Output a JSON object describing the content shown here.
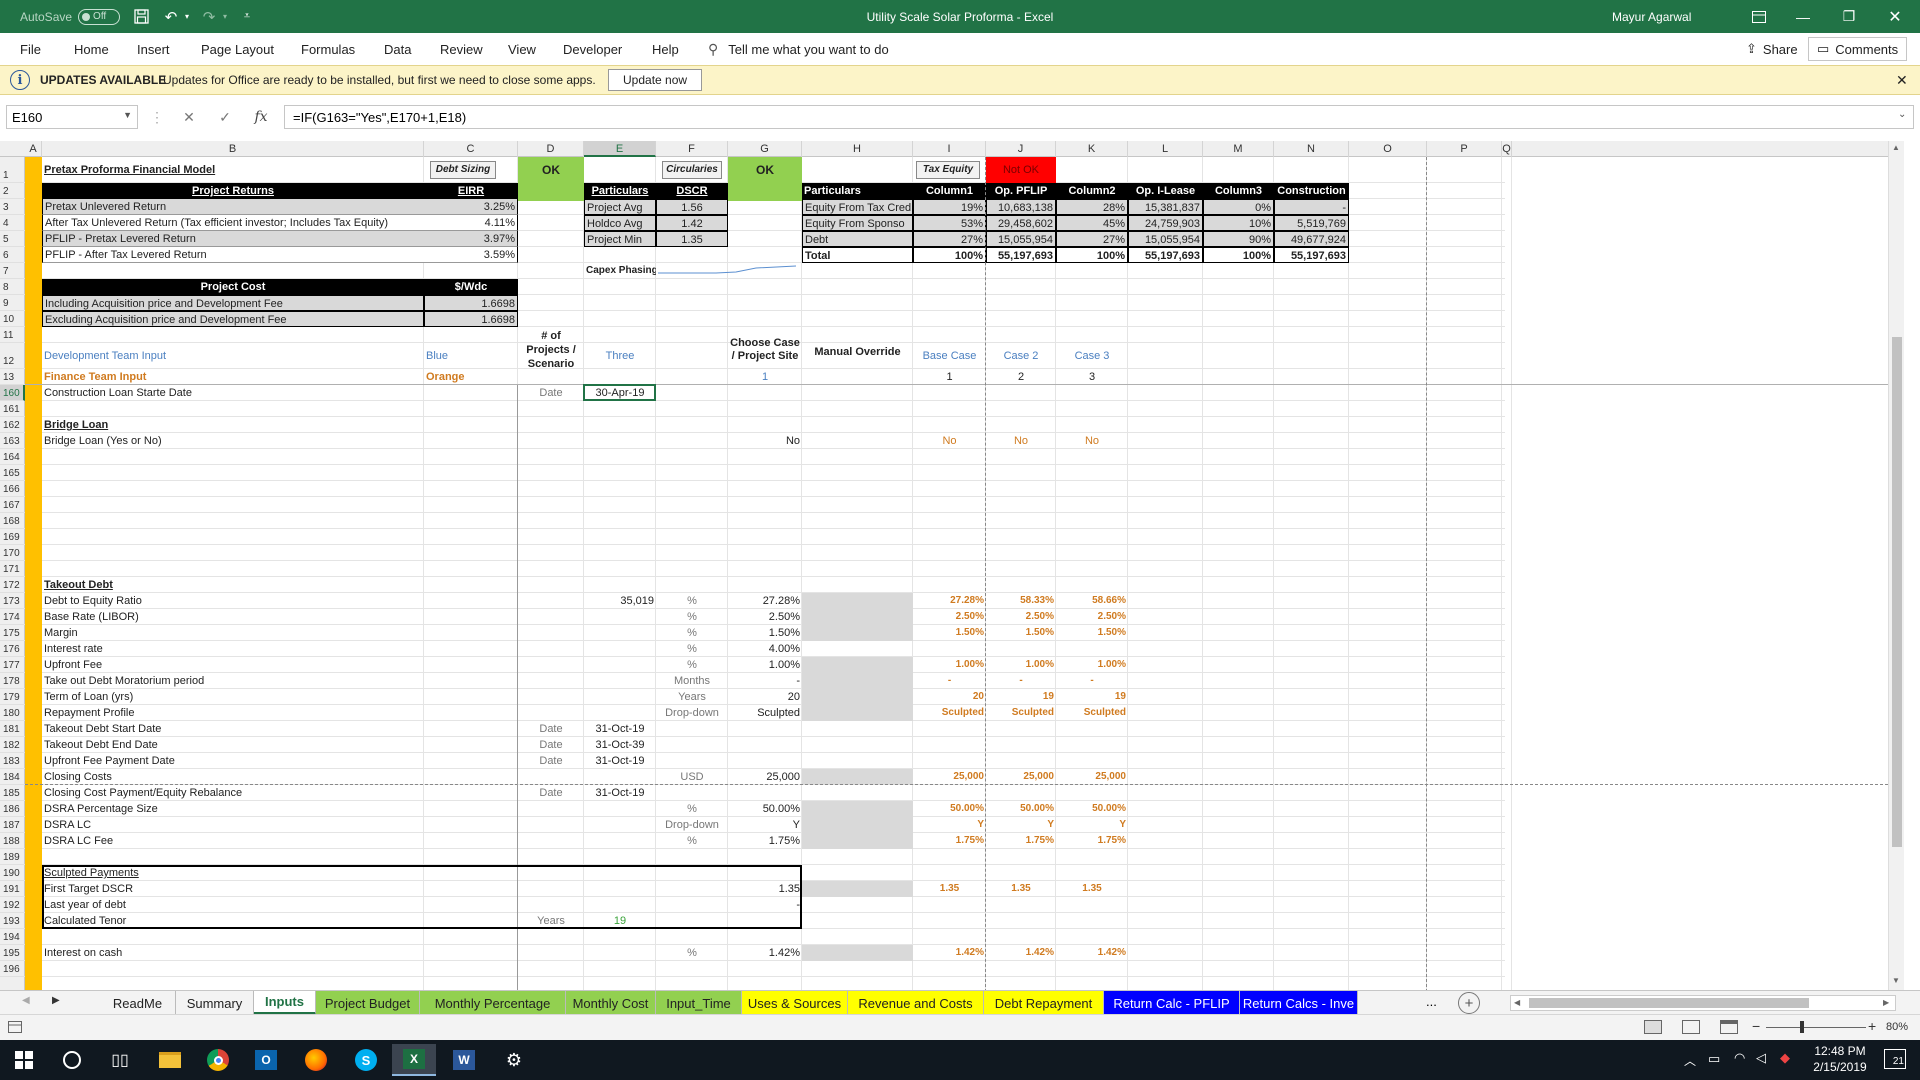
{
  "titlebar": {
    "autosave_label": "AutoSave",
    "autosave_state": "Off",
    "title": "Utility Scale Solar Proforma  -  Excel",
    "user": "Mayur Agarwal"
  },
  "ribbon": {
    "tabs": [
      "File",
      "Home",
      "Insert",
      "Page Layout",
      "Formulas",
      "Data",
      "Review",
      "View",
      "Developer",
      "Help"
    ],
    "tell_me": "Tell me what you want to do",
    "share": "Share",
    "comments": "Comments"
  },
  "updatebar": {
    "title": "UPDATES AVAILABLE",
    "message": "Updates for Office are ready to be installed, but first we need to close some apps.",
    "button": "Update now"
  },
  "formulabar": {
    "cell_ref": "E160",
    "formula": "=IF(G163=\"Yes\",E170+1,E18)",
    "fx": "fx"
  },
  "columns": [
    "A",
    "B",
    "C",
    "D",
    "E",
    "F",
    "G",
    "H",
    "I",
    "J",
    "K",
    "L",
    "M",
    "N",
    "O",
    "P",
    "Q"
  ],
  "rows": [
    "1",
    "2",
    "3",
    "4",
    "5",
    "6",
    "7",
    "8",
    "9",
    "10",
    "11",
    "12",
    "13",
    "160",
    "161",
    "162",
    "163",
    "164",
    "165",
    "166",
    "167",
    "168",
    "169",
    "170",
    "171",
    "172",
    "173",
    "174",
    "175",
    "176",
    "177",
    "178",
    "179",
    "180",
    "181",
    "182",
    "183",
    "184",
    "185",
    "186",
    "187",
    "188",
    "189",
    "190",
    "191",
    "192",
    "193",
    "194",
    "195",
    "196"
  ],
  "top": {
    "model_title": "Pretax Proforma Financial Model",
    "btn_debt_sizing": "Debt Sizing",
    "ok1": "OK",
    "btn_circularies": "Circularies",
    "ok2": "OK",
    "btn_tax_equity": "Tax Equity",
    "not_ok": "Not OK",
    "returns_header": "Project Returns",
    "eirr_header": "EIRR",
    "returns": [
      [
        "Pretax Unlevered Return",
        "3.25%"
      ],
      [
        "After Tax Unlevered Return (Tax efficient investor; Includes Tax Equity)",
        "4.11%"
      ],
      [
        "PFLIP - Pretax Levered Return",
        "3.97%"
      ],
      [
        "PFLIP - After Tax Levered Return",
        "3.59%"
      ]
    ],
    "dscr_headers": [
      "Particulars",
      "DSCR"
    ],
    "dscr": [
      [
        "Project Avg",
        "1.56"
      ],
      [
        "Holdco Avg",
        "1.42"
      ],
      [
        "Project Min",
        "1.35"
      ]
    ],
    "capex_label": "Capex Phasing",
    "cost_header": "Project Cost",
    "cost_unit": "$/Wdc",
    "costs": [
      [
        "Including Acquisition price and Development Fee",
        "1.6698"
      ],
      [
        "Excluding Acquisition price and Development Fee",
        "1.6698"
      ]
    ],
    "equity_headers": [
      "Particulars",
      "Column1",
      "Op. PFLIP",
      "Column2",
      "Op. I-Lease",
      "Column3",
      "Construction"
    ],
    "equity": [
      [
        "Equity From Tax Cred",
        "19%",
        "10,683,138",
        "28%",
        "15,381,837",
        "0%",
        "-"
      ],
      [
        "Equity From Sponso",
        "53%",
        "29,458,602",
        "45%",
        "24,759,903",
        "10%",
        "5,519,769"
      ],
      [
        "Debt",
        "27%",
        "15,055,954",
        "27%",
        "15,055,954",
        "90%",
        "49,677,924"
      ],
      [
        "Total",
        "100%",
        "55,197,693",
        "100%",
        "55,197,693",
        "100%",
        "55,197,693"
      ]
    ]
  },
  "legend": {
    "dev_input": "Development Team Input",
    "dev_color": "Blue",
    "fin_input": "Finance Team Input",
    "fin_color": "Orange",
    "projects_label": "# of Projects / Scenario",
    "projects_value": "Three",
    "choose_case": "Choose Case / Project Site",
    "choose_value": "1",
    "manual_override": "Manual Override",
    "case_labels": [
      "Base Case",
      "Case 2",
      "Case 3"
    ],
    "case_numbers": [
      "1",
      "2",
      "3"
    ]
  },
  "body": {
    "r160": {
      "label": "Construction Loan Starte Date",
      "unit": "Date",
      "value": "30-Apr-19"
    },
    "r162": "Bridge Loan",
    "r163": {
      "label": "Bridge Loan (Yes or No)",
      "g": "No",
      "cases": [
        "No",
        "No",
        "No"
      ]
    },
    "r172": "Takeout Debt",
    "takeout": [
      {
        "label": "Debt to Equity Ratio",
        "e": "35,019",
        "f": "%",
        "g": "27.28%",
        "cases": [
          "27.28%",
          "58.33%",
          "58.66%"
        ]
      },
      {
        "label": "Base Rate (LIBOR)",
        "f": "%",
        "g": "2.50%",
        "cases": [
          "2.50%",
          "2.50%",
          "2.50%"
        ]
      },
      {
        "label": "Margin",
        "f": "%",
        "g": "1.50%",
        "cases": [
          "1.50%",
          "1.50%",
          "1.50%"
        ]
      },
      {
        "label": "Interest rate",
        "f": "%",
        "g": "4.00%",
        "cases": [
          "",
          "",
          ""
        ]
      },
      {
        "label": "Upfront Fee",
        "f": "%",
        "g": "1.00%",
        "cases": [
          "1.00%",
          "1.00%",
          "1.00%"
        ]
      },
      {
        "label": "Take out Debt Moratorium period",
        "f": "Months",
        "g": "-",
        "cases": [
          "-",
          "-",
          "-"
        ]
      },
      {
        "label": "Term of Loan (yrs)",
        "f": "Years",
        "g": "20",
        "cases": [
          "20",
          "19",
          "19"
        ]
      },
      {
        "label": "Repayment Profile",
        "f": "Drop-down",
        "g": "Sculpted",
        "cases": [
          "Sculpted",
          "Sculpted",
          "Sculpted"
        ]
      },
      {
        "label": "Takeout Debt Start Date",
        "d": "Date",
        "e": "31-Oct-19"
      },
      {
        "label": "Takeout Debt End Date",
        "d": "Date",
        "e": "31-Oct-39"
      },
      {
        "label": "Upfront Fee Payment Date",
        "d": "Date",
        "e": "31-Oct-19"
      },
      {
        "label": "Closing Costs",
        "f": "USD",
        "g": "25,000",
        "cases": [
          "25,000",
          "25,000",
          "25,000"
        ]
      },
      {
        "label": "Closing Cost Payment/Equity Rebalance",
        "d": "Date",
        "e": "31-Oct-19"
      },
      {
        "label": "DSRA Percentage Size",
        "f": "%",
        "g": "50.00%",
        "cases": [
          "50.00%",
          "50.00%",
          "50.00%"
        ]
      },
      {
        "label": "DSRA LC",
        "f": "Drop-down",
        "g": "Y",
        "cases": [
          "Y",
          "Y",
          "Y"
        ]
      },
      {
        "label": "DSRA LC Fee",
        "f": "%",
        "g": "1.75%",
        "cases": [
          "1.75%",
          "1.75%",
          "1.75%"
        ]
      }
    ],
    "r190": "Sculpted Payments",
    "r191": {
      "label": "First Target DSCR",
      "g": "1.35",
      "cases": [
        "1.35",
        "1.35",
        "1.35"
      ]
    },
    "r192": {
      "label": "Last year  of debt",
      "g": "-"
    },
    "r193": {
      "label": "Calculated Tenor",
      "d": "Years",
      "e": "19"
    },
    "r195": {
      "label": "Interest on cash",
      "f": "%",
      "g": "1.42%",
      "cases": [
        "1.42%",
        "1.42%",
        "1.42%"
      ]
    }
  },
  "sheets": [
    {
      "name": "ReadMe",
      "bg": "#f3f3f3",
      "fg": "#222"
    },
    {
      "name": "Summary",
      "bg": "#f3f3f3",
      "fg": "#222"
    },
    {
      "name": "Inputs",
      "bg": "#ffffff",
      "fg": "#217346"
    },
    {
      "name": "Project Budget",
      "bg": "#92d050",
      "fg": "#222"
    },
    {
      "name": "Monthly Percentage",
      "bg": "#92d050",
      "fg": "#222"
    },
    {
      "name": "Monthly Cost",
      "bg": "#92d050",
      "fg": "#222"
    },
    {
      "name": "Input_Time",
      "bg": "#92d050",
      "fg": "#222"
    },
    {
      "name": "Uses & Sources",
      "bg": "#ffff00",
      "fg": "#222"
    },
    {
      "name": "Revenue and Costs",
      "bg": "#ffff00",
      "fg": "#222"
    },
    {
      "name": "Debt Repayment",
      "bg": "#ffff00",
      "fg": "#222"
    },
    {
      "name": "Return Calc - PFLIP",
      "bg": "#0000ff",
      "fg": "#ffffff"
    },
    {
      "name": "Return Calcs - Inve",
      "bg": "#0000ff",
      "fg": "#ffffff"
    }
  ],
  "sheets_more": "...",
  "status": {
    "zoom": "80%"
  },
  "taskbar": {
    "time": "12:48 PM",
    "date": "2/15/2019",
    "notif": "21"
  },
  "colors": {
    "excel_green": "#217346",
    "yellow_band": "#ffc000",
    "ok_green": "#92d050",
    "not_ok_red": "#ff0000",
    "finance_orange": "#d07b20",
    "dev_blue": "#4a7fc0"
  }
}
